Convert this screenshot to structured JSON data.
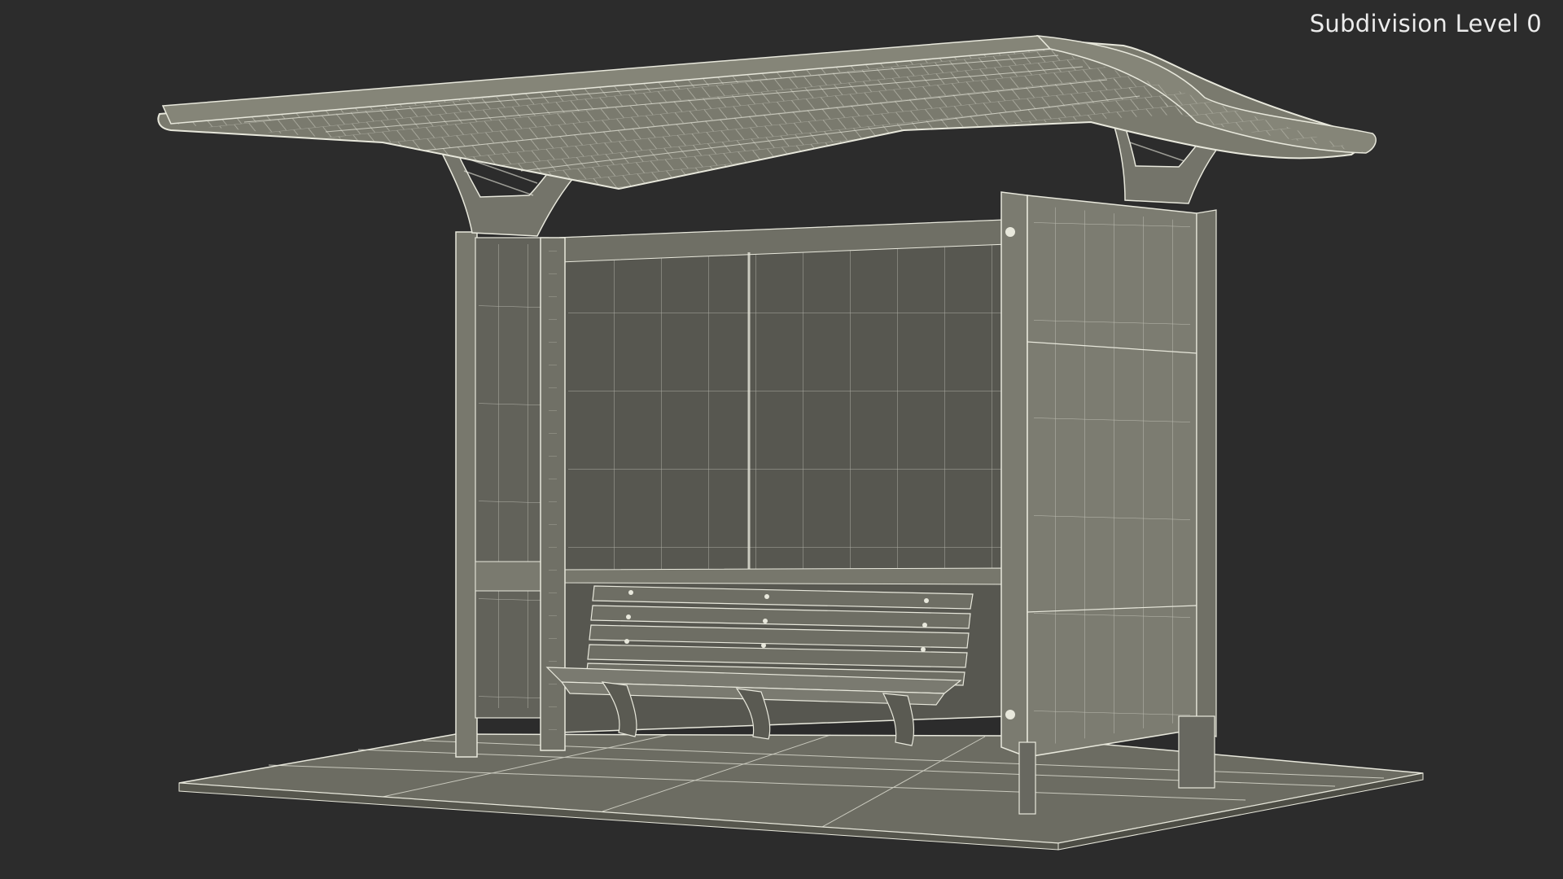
{
  "viewport": {
    "label": "Subdivision Level 0",
    "model": "Bus Stop Shelter",
    "render_mode": "wireframe-on-shaded"
  },
  "colors": {
    "background": "#2c2c2c",
    "surface": "#76766a",
    "surface_dark": "#5d5d53",
    "panel_back": "#55554b",
    "floor": "#6c6c62",
    "wire": "#e8e8dc",
    "label": "#ececec"
  }
}
